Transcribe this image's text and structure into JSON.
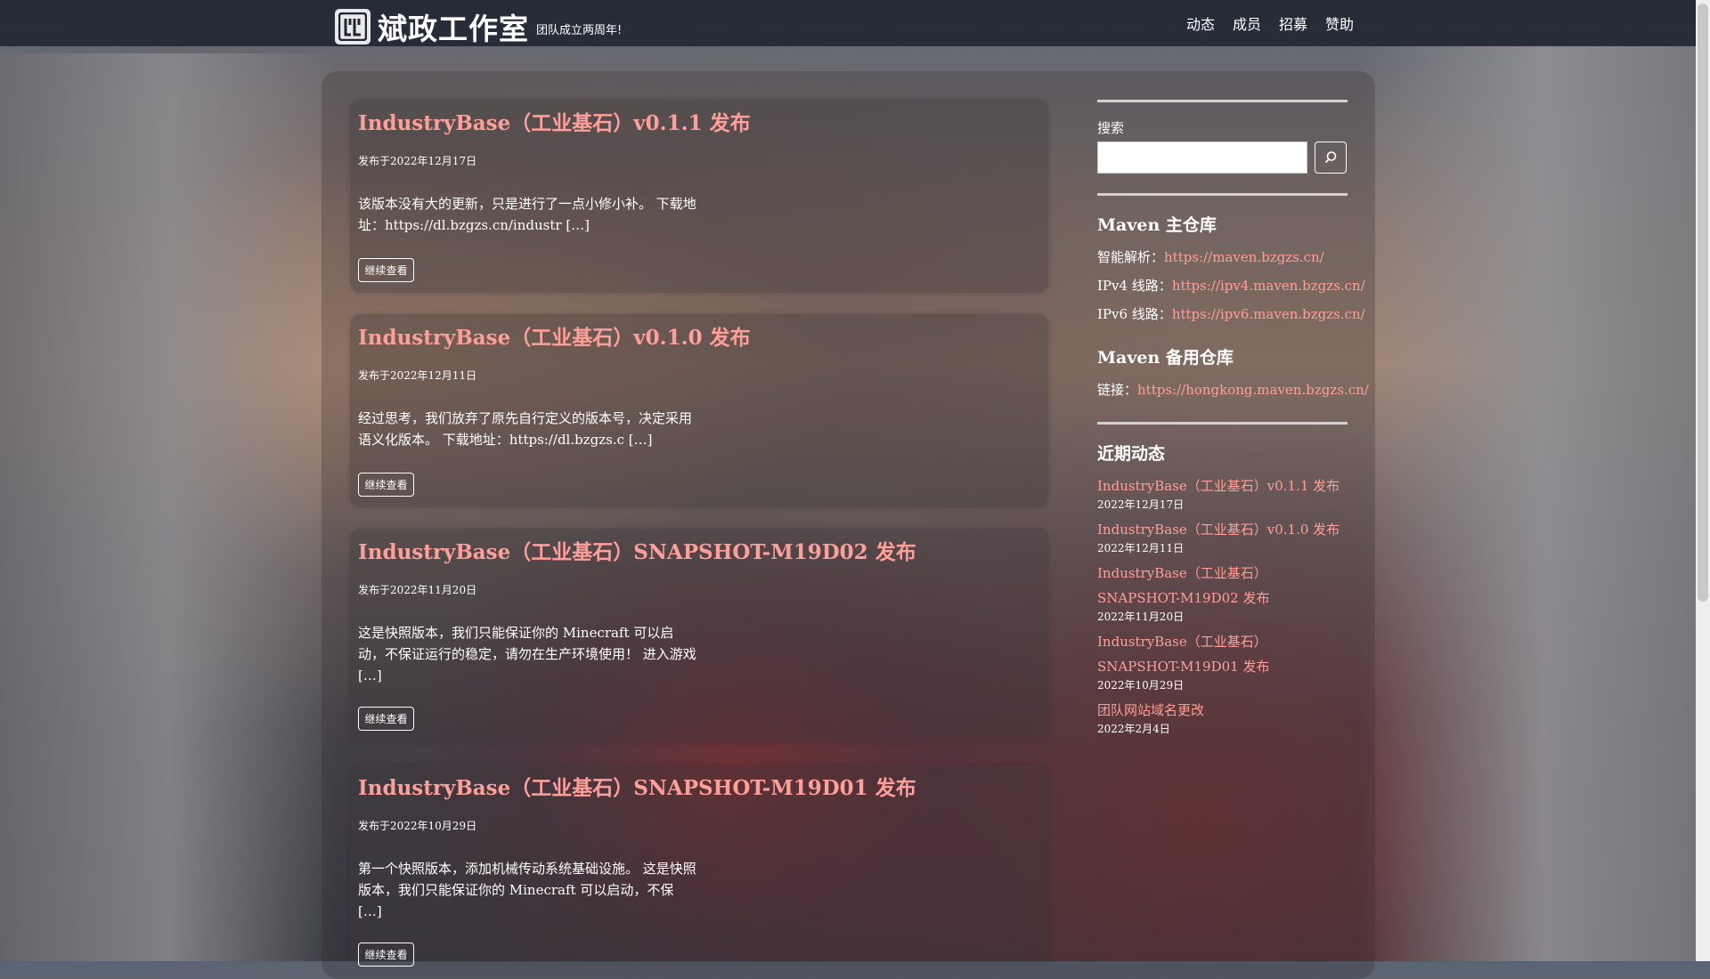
{
  "header": {
    "site_title": "斌政工作室",
    "tagline": "团队成立两周年!",
    "nav": [
      "动态",
      "成员",
      "招募",
      "赞助"
    ]
  },
  "posts": [
    {
      "title": "IndustryBase（工业基石）v0.1.1 发布",
      "date": "发布于2022年12月17日",
      "excerpt": "该版本没有大的更新，只是进行了一点小修小补。 下载地址：https://dl.bzgzs.cn/industr […]",
      "more": "继续查看"
    },
    {
      "title": "IndustryBase（工业基石）v0.1.0 发布",
      "date": "发布于2022年12月11日",
      "excerpt": "经过思考，我们放弃了原先自行定义的版本号，决定采用语义化版本。 下载地址：https://dl.bzgzs.c […]",
      "more": "继续查看"
    },
    {
      "title": "IndustryBase（工业基石）SNAPSHOT-M19D02 发布",
      "date": "发布于2022年11月20日",
      "excerpt": "这是快照版本，我们只能保证你的 Minecraft 可以启动，不保证运行的稳定，请勿在生产环境使用！ 进入游戏 […]",
      "more": "继续查看"
    },
    {
      "title": "IndustryBase（工业基石）SNAPSHOT-M19D01 发布",
      "date": "发布于2022年10月29日",
      "excerpt": "第一个快照版本，添加机械传动系统基础设施。 这是快照版本，我们只能保证你的 Minecraft 可以启动，不保 […]",
      "more": "继续查看"
    }
  ],
  "sidebar": {
    "search": {
      "label": "搜索",
      "placeholder": ""
    },
    "maven_main": {
      "title": "Maven 主仓库",
      "lines": [
        {
          "label": "智能解析：",
          "url": "https://maven.bzgzs.cn/"
        },
        {
          "label": "IPv4 线路：",
          "url": "https://ipv4.maven.bzgzs.cn/"
        },
        {
          "label": "IPv6 线路：",
          "url": "https://ipv6.maven.bzgzs.cn/"
        }
      ]
    },
    "maven_backup": {
      "title": "Maven 备用仓库",
      "label": "链接：",
      "url": "https://hongkong.maven.bzgzs.cn/"
    },
    "recent": {
      "title": "近期动态",
      "items": [
        {
          "title": "IndustryBase（工业基石）v0.1.1 发布",
          "date": "2022年12月17日"
        },
        {
          "title": "IndustryBase（工业基石）v0.1.0 发布",
          "date": "2022年12月11日"
        },
        {
          "title": "IndustryBase（工业基石）SNAPSHOT-M19D02 发布",
          "date": "2022年11月20日"
        },
        {
          "title": "IndustryBase（工业基石）SNAPSHOT-M19D01 发布",
          "date": "2022年10月29日"
        },
        {
          "title": "团队网站域名更改",
          "date": "2022年2月4日"
        }
      ]
    }
  },
  "colors": {
    "accent": "#ff9f99",
    "topbar": "#1e2430",
    "text": "#ffffff"
  }
}
